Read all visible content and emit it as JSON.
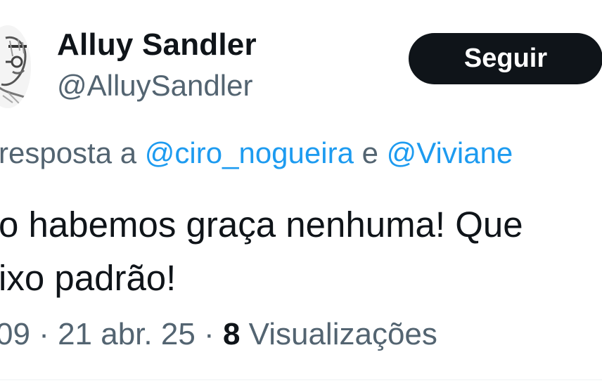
{
  "author": {
    "display_name": "Alluy Sandler",
    "handle": "@AlluySandler",
    "avatar_icon": "profile-photo-sketch"
  },
  "follow_button": {
    "label": "Seguir"
  },
  "reply_context": {
    "prefix": "resposta a",
    "mention_1": "@ciro_nogueira",
    "conjunction": "e",
    "mention_2": "@Viviane"
  },
  "tweet": {
    "line_1": "o habemos graça nenhuma! Que",
    "line_2": "ixo padrão!"
  },
  "meta": {
    "time": "09",
    "separator": "·",
    "date": "21 abr. 25",
    "views_count": "8",
    "views_label": "Visualizações"
  },
  "colors": {
    "text": "#0f1419",
    "secondary": "#536471",
    "link": "#1d9bf0",
    "button_bg": "#0f1419",
    "button_text": "#ffffff"
  }
}
